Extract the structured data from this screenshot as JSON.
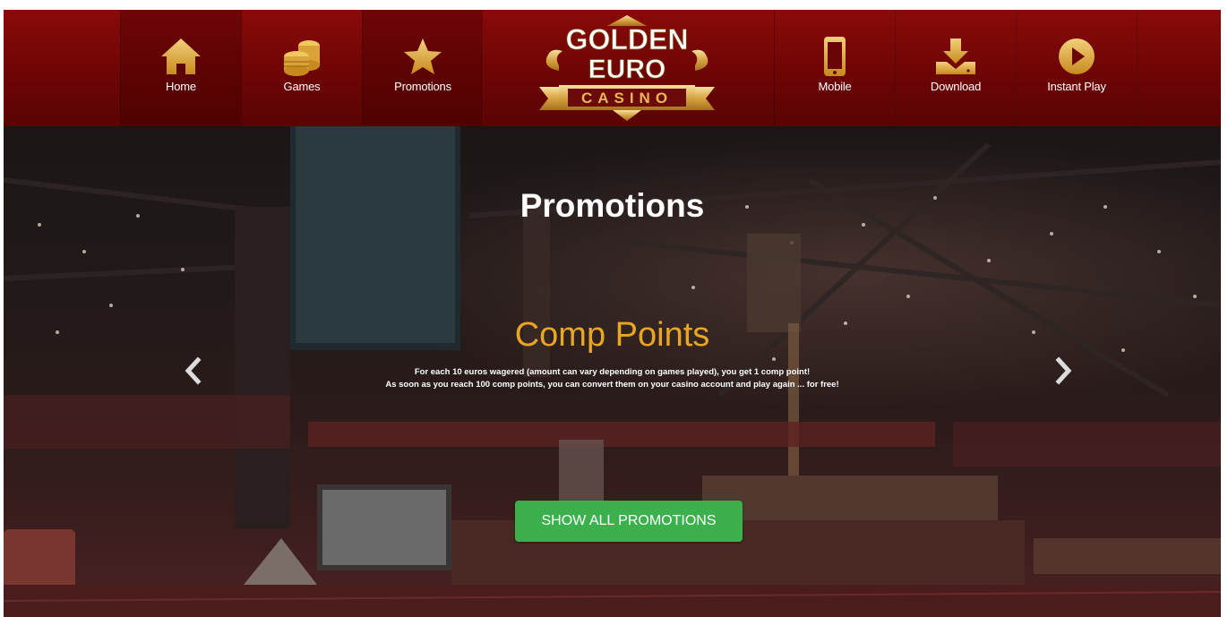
{
  "nav": {
    "home": "Home",
    "games": "Games",
    "promotions": "Promotions",
    "mobile": "Mobile",
    "download": "Download",
    "instant_play": "Instant Play"
  },
  "logo": {
    "line1": "GOLDEN",
    "line2": "EURO",
    "line3": "CASINO"
  },
  "hero": {
    "title": "Promotions",
    "promo_title": "Comp Points",
    "promo_line1": "For each 10 euros wagered (amount can vary depending on games played), you get 1 comp point!",
    "promo_line2": "As soon as you reach 100 comp points, you can convert them on your casino account and play again ... for free!",
    "cta": "SHOW ALL PROMOTIONS"
  },
  "icons": {
    "home": "home-icon",
    "games": "coins-icon",
    "promotions": "star-icon",
    "mobile": "phone-icon",
    "download": "download-icon",
    "instant_play": "play-icon",
    "prev": "chevron-left-icon",
    "next": "chevron-right-icon"
  },
  "colors": {
    "nav_bg": "#6e0505",
    "accent_gold": "#e8a623",
    "cta_green": "#3bb04d"
  }
}
